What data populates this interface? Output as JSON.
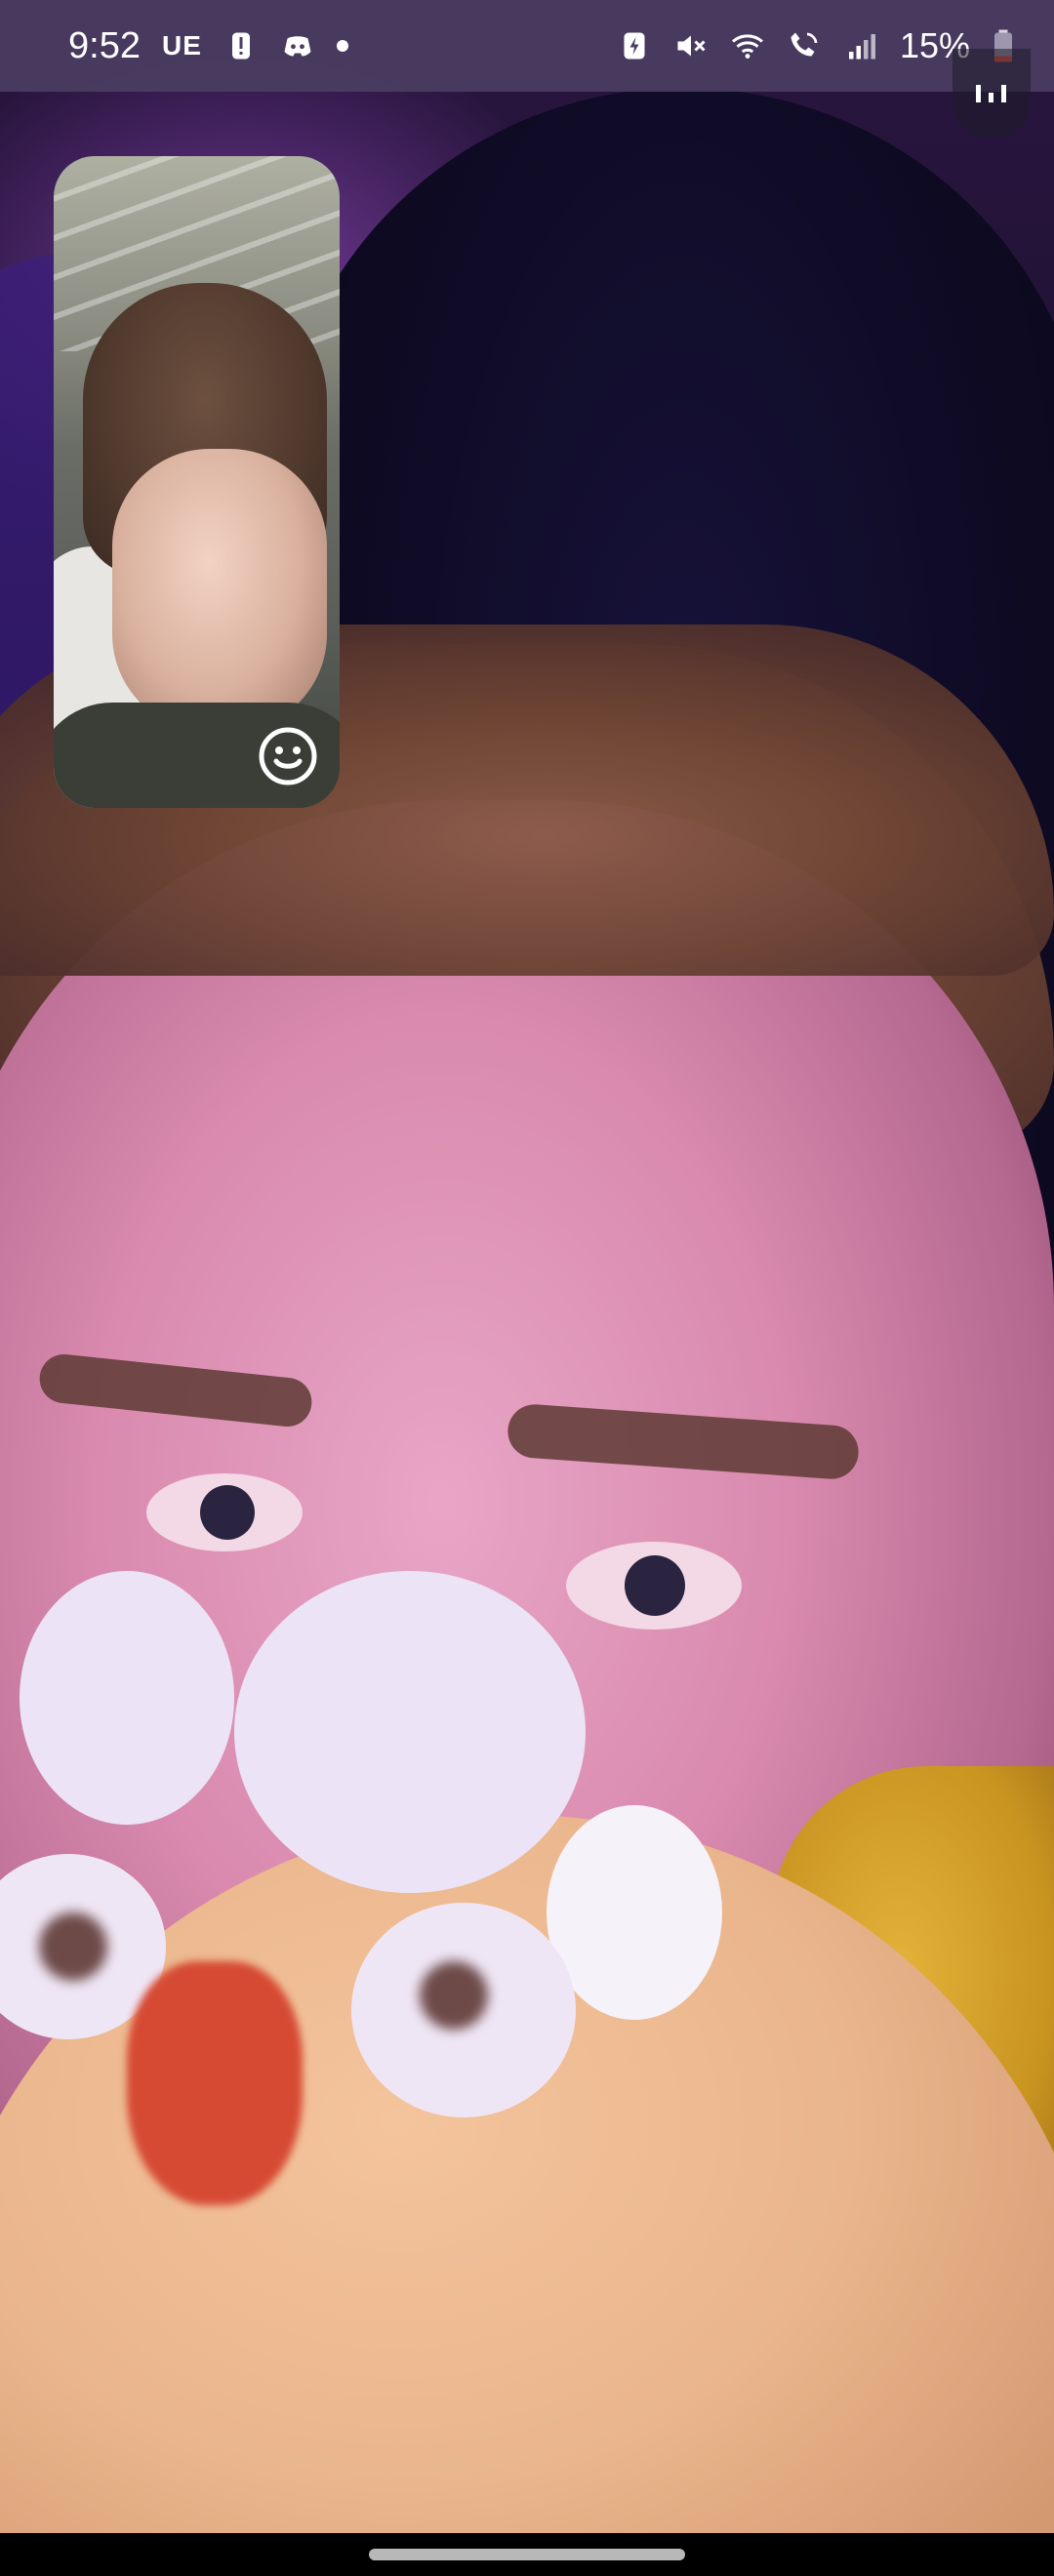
{
  "status_bar": {
    "time": "9:52",
    "carrier_label": "UE",
    "battery_percent": "15%",
    "icons_left": [
      "alert-icon",
      "discord-icon",
      "notification-dot"
    ],
    "icons_right": [
      "battery-saver-icon",
      "mute-icon",
      "wifi-icon",
      "wifi-calling-icon",
      "signal-icon",
      "battery-icon"
    ]
  },
  "call": {
    "remote_video": "remote-participant-video",
    "self_preview": "local-camera-preview",
    "effects_icon": "smiley-face-icon",
    "stats_icon": "signal-bars-icon"
  },
  "colors": {
    "status_bar_bg": "#4b3e62",
    "accent_purple": "#b45ae6",
    "battery_low": "#e8553e"
  }
}
